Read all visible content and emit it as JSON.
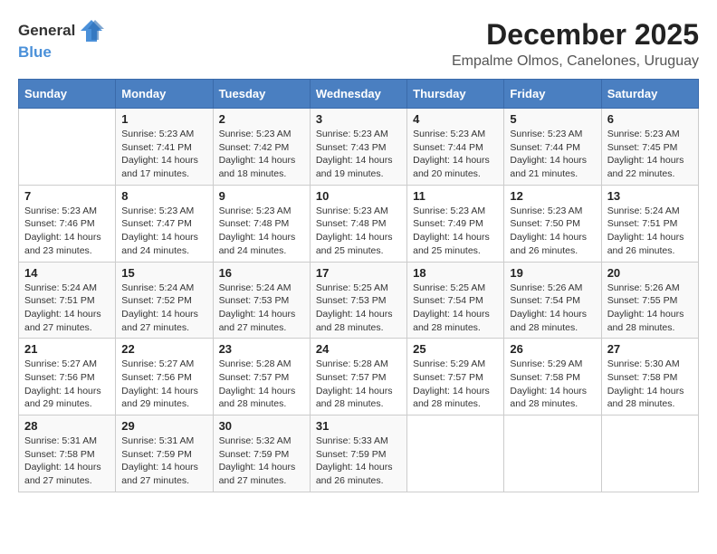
{
  "header": {
    "logo_general": "General",
    "logo_blue": "Blue",
    "month_title": "December 2025",
    "subtitle": "Empalme Olmos, Canelones, Uruguay"
  },
  "calendar": {
    "days_of_week": [
      "Sunday",
      "Monday",
      "Tuesday",
      "Wednesday",
      "Thursday",
      "Friday",
      "Saturday"
    ],
    "weeks": [
      [
        {
          "day": "",
          "sunrise": "",
          "sunset": "",
          "daylight": ""
        },
        {
          "day": "1",
          "sunrise": "Sunrise: 5:23 AM",
          "sunset": "Sunset: 7:41 PM",
          "daylight": "Daylight: 14 hours and 17 minutes."
        },
        {
          "day": "2",
          "sunrise": "Sunrise: 5:23 AM",
          "sunset": "Sunset: 7:42 PM",
          "daylight": "Daylight: 14 hours and 18 minutes."
        },
        {
          "day": "3",
          "sunrise": "Sunrise: 5:23 AM",
          "sunset": "Sunset: 7:43 PM",
          "daylight": "Daylight: 14 hours and 19 minutes."
        },
        {
          "day": "4",
          "sunrise": "Sunrise: 5:23 AM",
          "sunset": "Sunset: 7:44 PM",
          "daylight": "Daylight: 14 hours and 20 minutes."
        },
        {
          "day": "5",
          "sunrise": "Sunrise: 5:23 AM",
          "sunset": "Sunset: 7:44 PM",
          "daylight": "Daylight: 14 hours and 21 minutes."
        },
        {
          "day": "6",
          "sunrise": "Sunrise: 5:23 AM",
          "sunset": "Sunset: 7:45 PM",
          "daylight": "Daylight: 14 hours and 22 minutes."
        }
      ],
      [
        {
          "day": "7",
          "sunrise": "Sunrise: 5:23 AM",
          "sunset": "Sunset: 7:46 PM",
          "daylight": "Daylight: 14 hours and 23 minutes."
        },
        {
          "day": "8",
          "sunrise": "Sunrise: 5:23 AM",
          "sunset": "Sunset: 7:47 PM",
          "daylight": "Daylight: 14 hours and 24 minutes."
        },
        {
          "day": "9",
          "sunrise": "Sunrise: 5:23 AM",
          "sunset": "Sunset: 7:48 PM",
          "daylight": "Daylight: 14 hours and 24 minutes."
        },
        {
          "day": "10",
          "sunrise": "Sunrise: 5:23 AM",
          "sunset": "Sunset: 7:48 PM",
          "daylight": "Daylight: 14 hours and 25 minutes."
        },
        {
          "day": "11",
          "sunrise": "Sunrise: 5:23 AM",
          "sunset": "Sunset: 7:49 PM",
          "daylight": "Daylight: 14 hours and 25 minutes."
        },
        {
          "day": "12",
          "sunrise": "Sunrise: 5:23 AM",
          "sunset": "Sunset: 7:50 PM",
          "daylight": "Daylight: 14 hours and 26 minutes."
        },
        {
          "day": "13",
          "sunrise": "Sunrise: 5:24 AM",
          "sunset": "Sunset: 7:51 PM",
          "daylight": "Daylight: 14 hours and 26 minutes."
        }
      ],
      [
        {
          "day": "14",
          "sunrise": "Sunrise: 5:24 AM",
          "sunset": "Sunset: 7:51 PM",
          "daylight": "Daylight: 14 hours and 27 minutes."
        },
        {
          "day": "15",
          "sunrise": "Sunrise: 5:24 AM",
          "sunset": "Sunset: 7:52 PM",
          "daylight": "Daylight: 14 hours and 27 minutes."
        },
        {
          "day": "16",
          "sunrise": "Sunrise: 5:24 AM",
          "sunset": "Sunset: 7:53 PM",
          "daylight": "Daylight: 14 hours and 27 minutes."
        },
        {
          "day": "17",
          "sunrise": "Sunrise: 5:25 AM",
          "sunset": "Sunset: 7:53 PM",
          "daylight": "Daylight: 14 hours and 28 minutes."
        },
        {
          "day": "18",
          "sunrise": "Sunrise: 5:25 AM",
          "sunset": "Sunset: 7:54 PM",
          "daylight": "Daylight: 14 hours and 28 minutes."
        },
        {
          "day": "19",
          "sunrise": "Sunrise: 5:26 AM",
          "sunset": "Sunset: 7:54 PM",
          "daylight": "Daylight: 14 hours and 28 minutes."
        },
        {
          "day": "20",
          "sunrise": "Sunrise: 5:26 AM",
          "sunset": "Sunset: 7:55 PM",
          "daylight": "Daylight: 14 hours and 28 minutes."
        }
      ],
      [
        {
          "day": "21",
          "sunrise": "Sunrise: 5:27 AM",
          "sunset": "Sunset: 7:56 PM",
          "daylight": "Daylight: 14 hours and 29 minutes."
        },
        {
          "day": "22",
          "sunrise": "Sunrise: 5:27 AM",
          "sunset": "Sunset: 7:56 PM",
          "daylight": "Daylight: 14 hours and 29 minutes."
        },
        {
          "day": "23",
          "sunrise": "Sunrise: 5:28 AM",
          "sunset": "Sunset: 7:57 PM",
          "daylight": "Daylight: 14 hours and 28 minutes."
        },
        {
          "day": "24",
          "sunrise": "Sunrise: 5:28 AM",
          "sunset": "Sunset: 7:57 PM",
          "daylight": "Daylight: 14 hours and 28 minutes."
        },
        {
          "day": "25",
          "sunrise": "Sunrise: 5:29 AM",
          "sunset": "Sunset: 7:57 PM",
          "daylight": "Daylight: 14 hours and 28 minutes."
        },
        {
          "day": "26",
          "sunrise": "Sunrise: 5:29 AM",
          "sunset": "Sunset: 7:58 PM",
          "daylight": "Daylight: 14 hours and 28 minutes."
        },
        {
          "day": "27",
          "sunrise": "Sunrise: 5:30 AM",
          "sunset": "Sunset: 7:58 PM",
          "daylight": "Daylight: 14 hours and 28 minutes."
        }
      ],
      [
        {
          "day": "28",
          "sunrise": "Sunrise: 5:31 AM",
          "sunset": "Sunset: 7:58 PM",
          "daylight": "Daylight: 14 hours and 27 minutes."
        },
        {
          "day": "29",
          "sunrise": "Sunrise: 5:31 AM",
          "sunset": "Sunset: 7:59 PM",
          "daylight": "Daylight: 14 hours and 27 minutes."
        },
        {
          "day": "30",
          "sunrise": "Sunrise: 5:32 AM",
          "sunset": "Sunset: 7:59 PM",
          "daylight": "Daylight: 14 hours and 27 minutes."
        },
        {
          "day": "31",
          "sunrise": "Sunrise: 5:33 AM",
          "sunset": "Sunset: 7:59 PM",
          "daylight": "Daylight: 14 hours and 26 minutes."
        },
        {
          "day": "",
          "sunrise": "",
          "sunset": "",
          "daylight": ""
        },
        {
          "day": "",
          "sunrise": "",
          "sunset": "",
          "daylight": ""
        },
        {
          "day": "",
          "sunrise": "",
          "sunset": "",
          "daylight": ""
        }
      ]
    ]
  }
}
